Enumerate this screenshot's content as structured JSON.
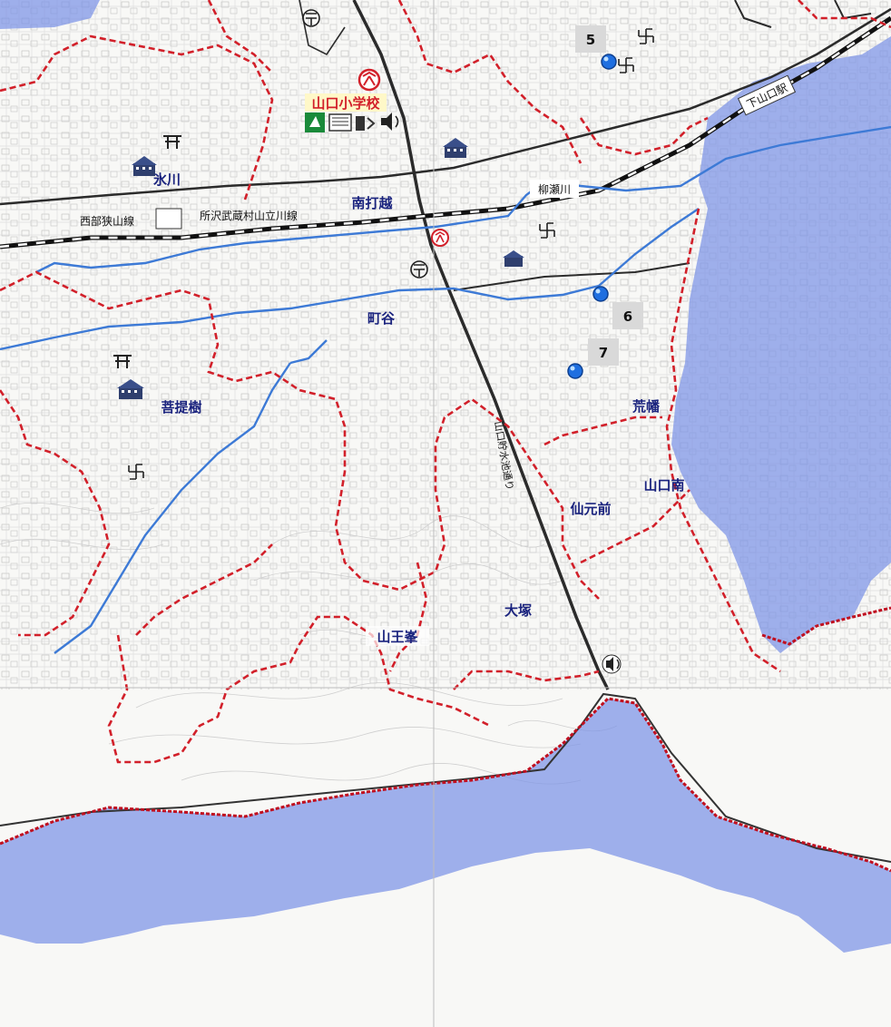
{
  "school": {
    "name": "山口小学校"
  },
  "station": {
    "name": "下山口駅"
  },
  "railway": {
    "name": "西部狭山線"
  },
  "road_label": "所沢武蔵村山立川線",
  "river": {
    "name": "柳瀬川"
  },
  "road_vertical": "山口貯水池通り",
  "districts": {
    "hikawa": "氷川",
    "minamiuchikoshi": "南打越",
    "machiya": "町谷",
    "bodaiju": "菩提樹",
    "arahata": "荒幡",
    "yamaguchiminami": "山口南",
    "sengenmae": "仙元前",
    "otsuka": "大塚",
    "sannomine": "山王峯"
  },
  "markers": [
    {
      "number": "5"
    },
    {
      "number": "6"
    },
    {
      "number": "7"
    }
  ],
  "colors": {
    "flood_zone": "#7b93e6",
    "boundary": "#d2202a",
    "stream": "#3d7ad6",
    "district_label": "#1a237e",
    "school_label": "#d2202a",
    "badge": "#d9d9d9"
  },
  "icons": [
    "shrine-icon",
    "temple-icon",
    "post-office-icon",
    "school-icon",
    "evacuation-shelter-icon",
    "speaker-icon",
    "location-pin-icon"
  ]
}
